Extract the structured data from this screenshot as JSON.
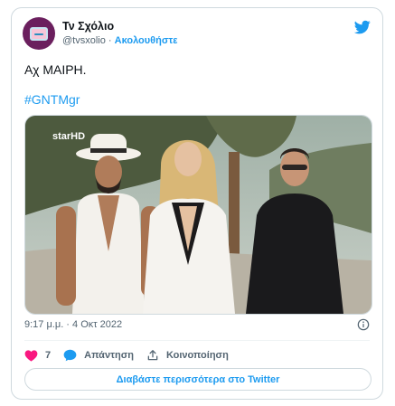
{
  "author": {
    "name": "Τν Σχόλιο",
    "handle": "@tvsxolio",
    "separator": " · ",
    "follow_label": "Ακολουθήστε"
  },
  "tweet": {
    "text": "Αχ ΜΑΙΡΗ.",
    "hashtag": "#GNTMgr",
    "timestamp": "9:17 μ.μ. · 4 Οκτ 2022"
  },
  "media": {
    "watermark": "starHD",
    "description_icon": "photo"
  },
  "actions": {
    "like_count": "7",
    "reply_label": "Απάντηση",
    "share_label": "Κοινοποίηση"
  },
  "footer": {
    "read_more_label": "Διαβάστε περισσότερα στο Twitter"
  },
  "colors": {
    "accent": "#1d9bf0",
    "like": "#f91880",
    "avatar_bg": "#6b1f5e"
  },
  "icons": [
    "twitter-bird-icon",
    "info-icon",
    "heart-icon",
    "reply-bubble-icon",
    "share-icon"
  ]
}
